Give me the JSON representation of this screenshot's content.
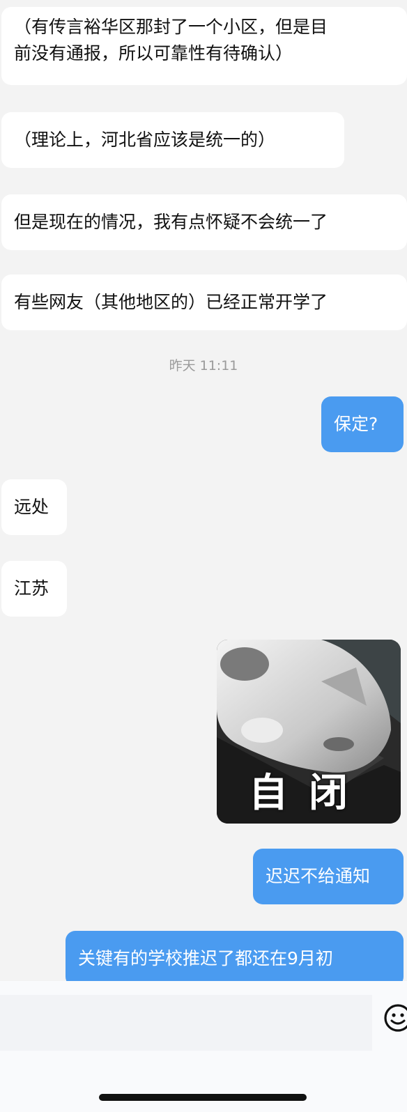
{
  "messages": [
    {
      "side": "left",
      "lines": [
        "（有传言裕华区那封了一个小区，但是目",
        "前没有通报，所以可靠性有待确认）"
      ]
    },
    {
      "side": "left",
      "text": "（理论上，河北省应该是统一的）"
    },
    {
      "side": "left",
      "text": "但是现在的情况，我有点怀疑不会统一了"
    },
    {
      "side": "left",
      "text": "有些网友（其他地区的）已经正常开学了"
    },
    {
      "side": "time",
      "text": "昨天 11:11"
    },
    {
      "side": "right",
      "text": "保定?"
    },
    {
      "side": "left",
      "text": "远处"
    },
    {
      "side": "left",
      "text": "江苏"
    },
    {
      "side": "right",
      "type": "sticker",
      "caption": "自闭"
    },
    {
      "side": "right",
      "text": "迟迟不给通知"
    },
    {
      "side": "right",
      "text": "关键有的学校推迟了都还在9月初"
    }
  ],
  "input": {
    "placeholder": ""
  },
  "icons": {
    "emoji": "smiley-icon"
  },
  "colors": {
    "background": "#f3f3f3",
    "incoming": "#ffffff",
    "outgoing": "#4a9bf0",
    "timestamp": "#9a9a9a"
  }
}
